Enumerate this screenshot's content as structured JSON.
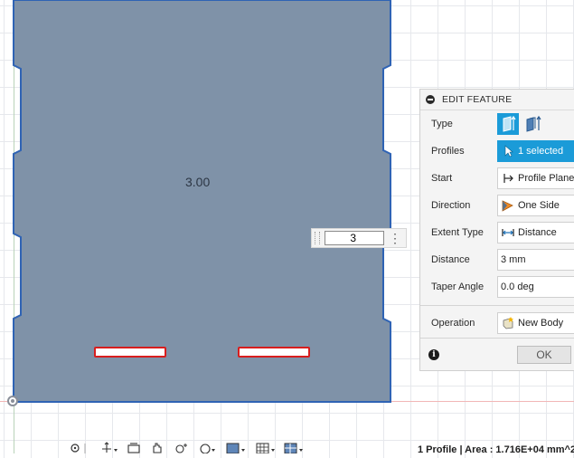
{
  "sketch": {
    "dimension_label": "3.00",
    "dimension_input_value": "3",
    "dimension_menu": "⋮"
  },
  "edit_feature": {
    "title": "EDIT FEATURE",
    "rows": {
      "type": {
        "label": "Type"
      },
      "profiles": {
        "label": "Profiles",
        "value": "1 selected"
      },
      "start": {
        "label": "Start",
        "value": "Profile Plane"
      },
      "direction": {
        "label": "Direction",
        "value": "One Side"
      },
      "extent_type": {
        "label": "Extent Type",
        "value": "Distance"
      },
      "distance": {
        "label": "Distance",
        "value": "3 mm"
      },
      "taper_angle": {
        "label": "Taper Angle",
        "value": "0.0 deg"
      },
      "operation": {
        "label": "Operation",
        "value": "New Body"
      }
    },
    "ok_label": "OK",
    "info_glyph": "i"
  },
  "status_bar": {
    "text": "1 Profile | Area : 1.716E+04 mm^2"
  },
  "colors": {
    "body_fill": "#7f92a8",
    "body_edge": "#2f63b4",
    "accent": "#1b9bd8",
    "slot_outline": "#d81e1e"
  },
  "icons": {
    "type_solid": "extrude-solid-icon",
    "type_thin": "extrude-thin-icon",
    "profiles": "cursor-arrow-icon",
    "start": "profile-plane-icon",
    "direction": "one-side-direction-icon",
    "extent": "distance-extent-icon",
    "operation": "new-body-icon"
  }
}
